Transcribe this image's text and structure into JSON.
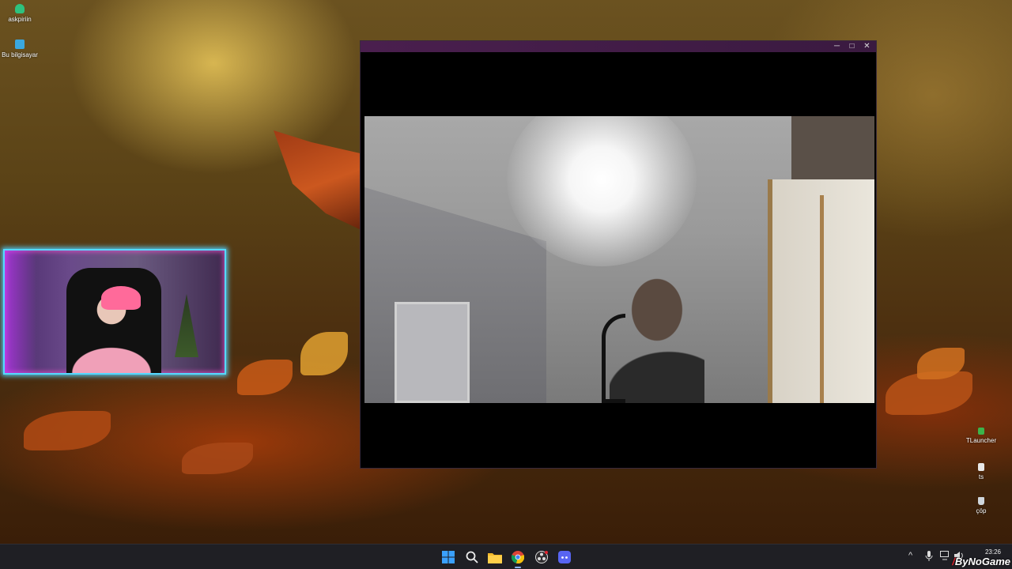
{
  "desktop": {
    "icons": [
      {
        "label": "askpiriin",
        "icon": "user-icon",
        "color": "#2ec27e"
      },
      {
        "label": "Bu bilgisayar",
        "icon": "computer-icon",
        "color": "#3aa8e0"
      },
      {
        "label": "TLauncher",
        "icon": "tlauncher-icon",
        "color": "#3cb34a"
      },
      {
        "label": "ts",
        "icon": "file-icon",
        "color": "#e8e8e8"
      },
      {
        "label": "çöp",
        "icon": "recycle-bin-icon",
        "color": "#cfd6dc"
      }
    ]
  },
  "window": {
    "minimize": "─",
    "maximize": "□",
    "close": "✕",
    "titlebar_color": "#4a1f4e"
  },
  "overlay": {
    "border_color": "#55d8ff",
    "glow_color": "#e650c8"
  },
  "taskbar": {
    "apps": [
      {
        "name": "start-button",
        "icon": "windows-icon"
      },
      {
        "name": "search-button",
        "icon": "search-icon"
      },
      {
        "name": "file-explorer",
        "icon": "folder-icon"
      },
      {
        "name": "chrome",
        "icon": "chrome-icon",
        "active": true
      },
      {
        "name": "obs",
        "icon": "obs-icon"
      },
      {
        "name": "discord",
        "icon": "discord-icon"
      }
    ],
    "tray": {
      "chevron": "^",
      "time": "23:26",
      "date": ""
    }
  },
  "watermark": {
    "slash": "/",
    "text": "ByNoGame"
  }
}
